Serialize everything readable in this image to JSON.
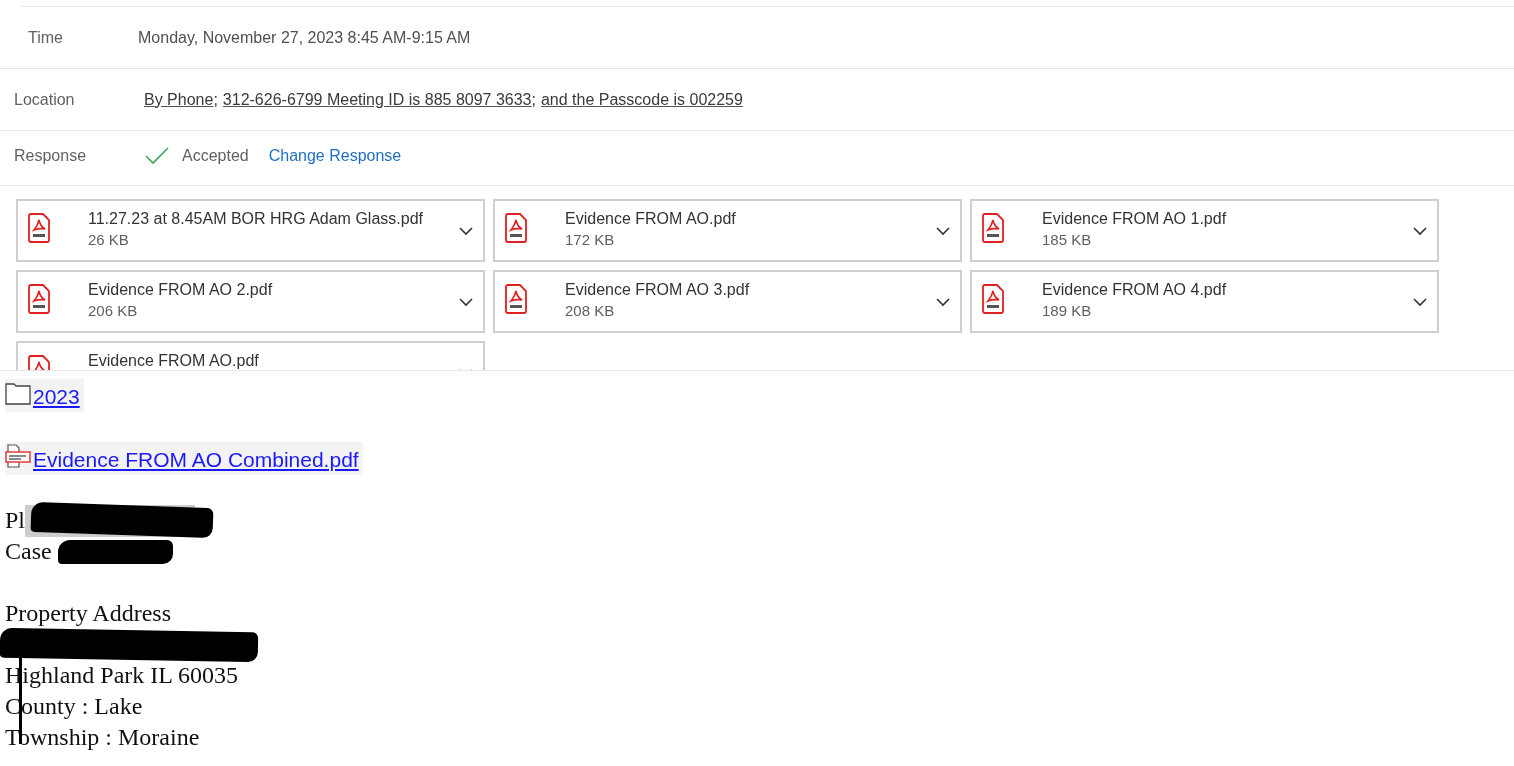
{
  "fields": [
    {
      "kind": "text",
      "label": "Time",
      "value": "Monday, November 27, 2023 8:45 AM-9:15 AM"
    },
    {
      "kind": "parts",
      "label": "Location",
      "parts": [
        {
          "kind": "link",
          "text": "By Phone"
        },
        {
          "kind": "plain",
          "text": ";"
        },
        {
          "kind": "link",
          "text": "312-626-6799 Meeting ID is 885 8097 3633"
        },
        {
          "kind": "plain",
          "text": ";"
        },
        {
          "kind": "link",
          "text": "and the Passcode is 002259"
        }
      ]
    },
    {
      "kind": "response",
      "label": "Response",
      "accepted": true,
      "status": "Accepted",
      "action": "Change Response"
    }
  ],
  "attachments": [
    {
      "name": "11.27.23 at 8.45AM BOR HRG Adam Glass.pdf",
      "size": "26 KB"
    },
    {
      "name": "Evidence FROM AO.pdf",
      "size": "172 KB"
    },
    {
      "name": "Evidence FROM AO 1.pdf",
      "size": "185 KB"
    },
    {
      "name": "Evidence FROM AO 2.pdf",
      "size": "206 KB"
    },
    {
      "name": "Evidence FROM AO 3.pdf",
      "size": "208 KB"
    },
    {
      "name": "Evidence FROM AO 4.pdf",
      "size": "189 KB"
    },
    {
      "name": "Evidence FROM AO.pdf"
    }
  ],
  "body": {
    "links": [
      {
        "kind": "folder",
        "text": "2023"
      },
      {
        "kind": "pdf",
        "text": "Evidence FROM AO Combined.pdf"
      }
    ],
    "paragraphs": [
      [
        {
          "text": "Pl",
          "redacted": true
        },
        {
          "text": "Case",
          "redacted": true
        }
      ],
      [
        {
          "text": "Property Address"
        },
        {
          "redacted": true
        },
        {
          "text": "Highland Park IL 60035"
        },
        {
          "text": "County : Lake"
        },
        {
          "text": "Township : Moraine"
        }
      ]
    ]
  }
}
